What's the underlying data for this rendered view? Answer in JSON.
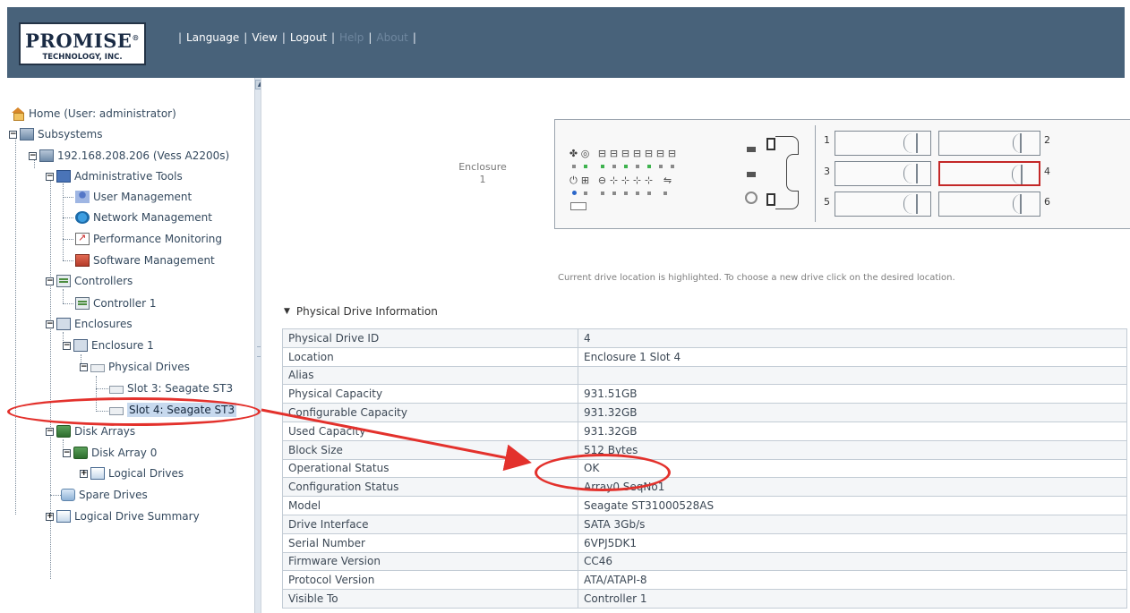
{
  "header": {
    "logo": {
      "brand": "PROMISE",
      "reg": "®",
      "sub": "TECHNOLOGY, INC."
    },
    "nav": [
      {
        "label": "Language",
        "dim": false
      },
      {
        "label": "View",
        "dim": false
      },
      {
        "label": "Logout",
        "dim": false
      },
      {
        "label": "Help",
        "dim": true
      },
      {
        "label": "About",
        "dim": true
      }
    ]
  },
  "tree": {
    "home": "Home (User: administrator)",
    "subsystems": "Subsystems",
    "subsystem": "192.168.208.206 (Vess A2200s)",
    "admin_tools": "Administrative Tools",
    "user_mgmt": "User Management",
    "network_mgmt": "Network Management",
    "perf_mon": "Performance Monitoring",
    "software_mgmt": "Software Management",
    "controllers": "Controllers",
    "controller1": "Controller 1",
    "enclosures": "Enclosures",
    "enclosure1": "Enclosure 1",
    "physical_drives": "Physical Drives",
    "slot3": "Slot 3: Seagate ST3",
    "slot4": "Slot 4: Seagate ST3",
    "disk_arrays": "Disk Arrays",
    "disk_array0": "Disk Array 0",
    "logical_drives": "Logical Drives",
    "spare_drives": "Spare Drives",
    "ld_summary": "Logical Drive Summary"
  },
  "enclosure": {
    "label_line1": "Enclosure",
    "label_line2": "1",
    "slot_numbers": [
      "1",
      "2",
      "3",
      "4",
      "5",
      "6"
    ],
    "selected_slot": "4",
    "hint": "Current drive location is highlighted. To choose a new drive click on the desired location."
  },
  "pdi": {
    "title": "Physical Drive Information",
    "rows": [
      {
        "key": "Physical Drive ID",
        "value": "4"
      },
      {
        "key": "Location",
        "value": "Enclosure 1 Slot 4"
      },
      {
        "key": "Alias",
        "value": ""
      },
      {
        "key": "Physical Capacity",
        "value": "931.51GB"
      },
      {
        "key": "Configurable Capacity",
        "value": "931.32GB"
      },
      {
        "key": "Used Capacity",
        "value": "931.32GB"
      },
      {
        "key": "Block Size",
        "value": "512 Bytes"
      },
      {
        "key": "Operational Status",
        "value": "OK"
      },
      {
        "key": "Configuration Status",
        "value": "Array0 SeqNo1"
      },
      {
        "key": "Model",
        "value": "Seagate ST31000528AS"
      },
      {
        "key": "Drive Interface",
        "value": "SATA 3Gb/s"
      },
      {
        "key": "Serial Number",
        "value": "6VPJ5DK1"
      },
      {
        "key": "Firmware Version",
        "value": "CC46"
      },
      {
        "key": "Protocol Version",
        "value": "ATA/ATAPI-8"
      },
      {
        "key": "Visible To",
        "value": "Controller 1"
      }
    ]
  },
  "colors": {
    "header_bg": "#48627a",
    "annotation_red": "#e3312c",
    "led_green": "#3fb34f",
    "led_blue": "#2a66c9",
    "selected_slot_border": "#c32828"
  }
}
